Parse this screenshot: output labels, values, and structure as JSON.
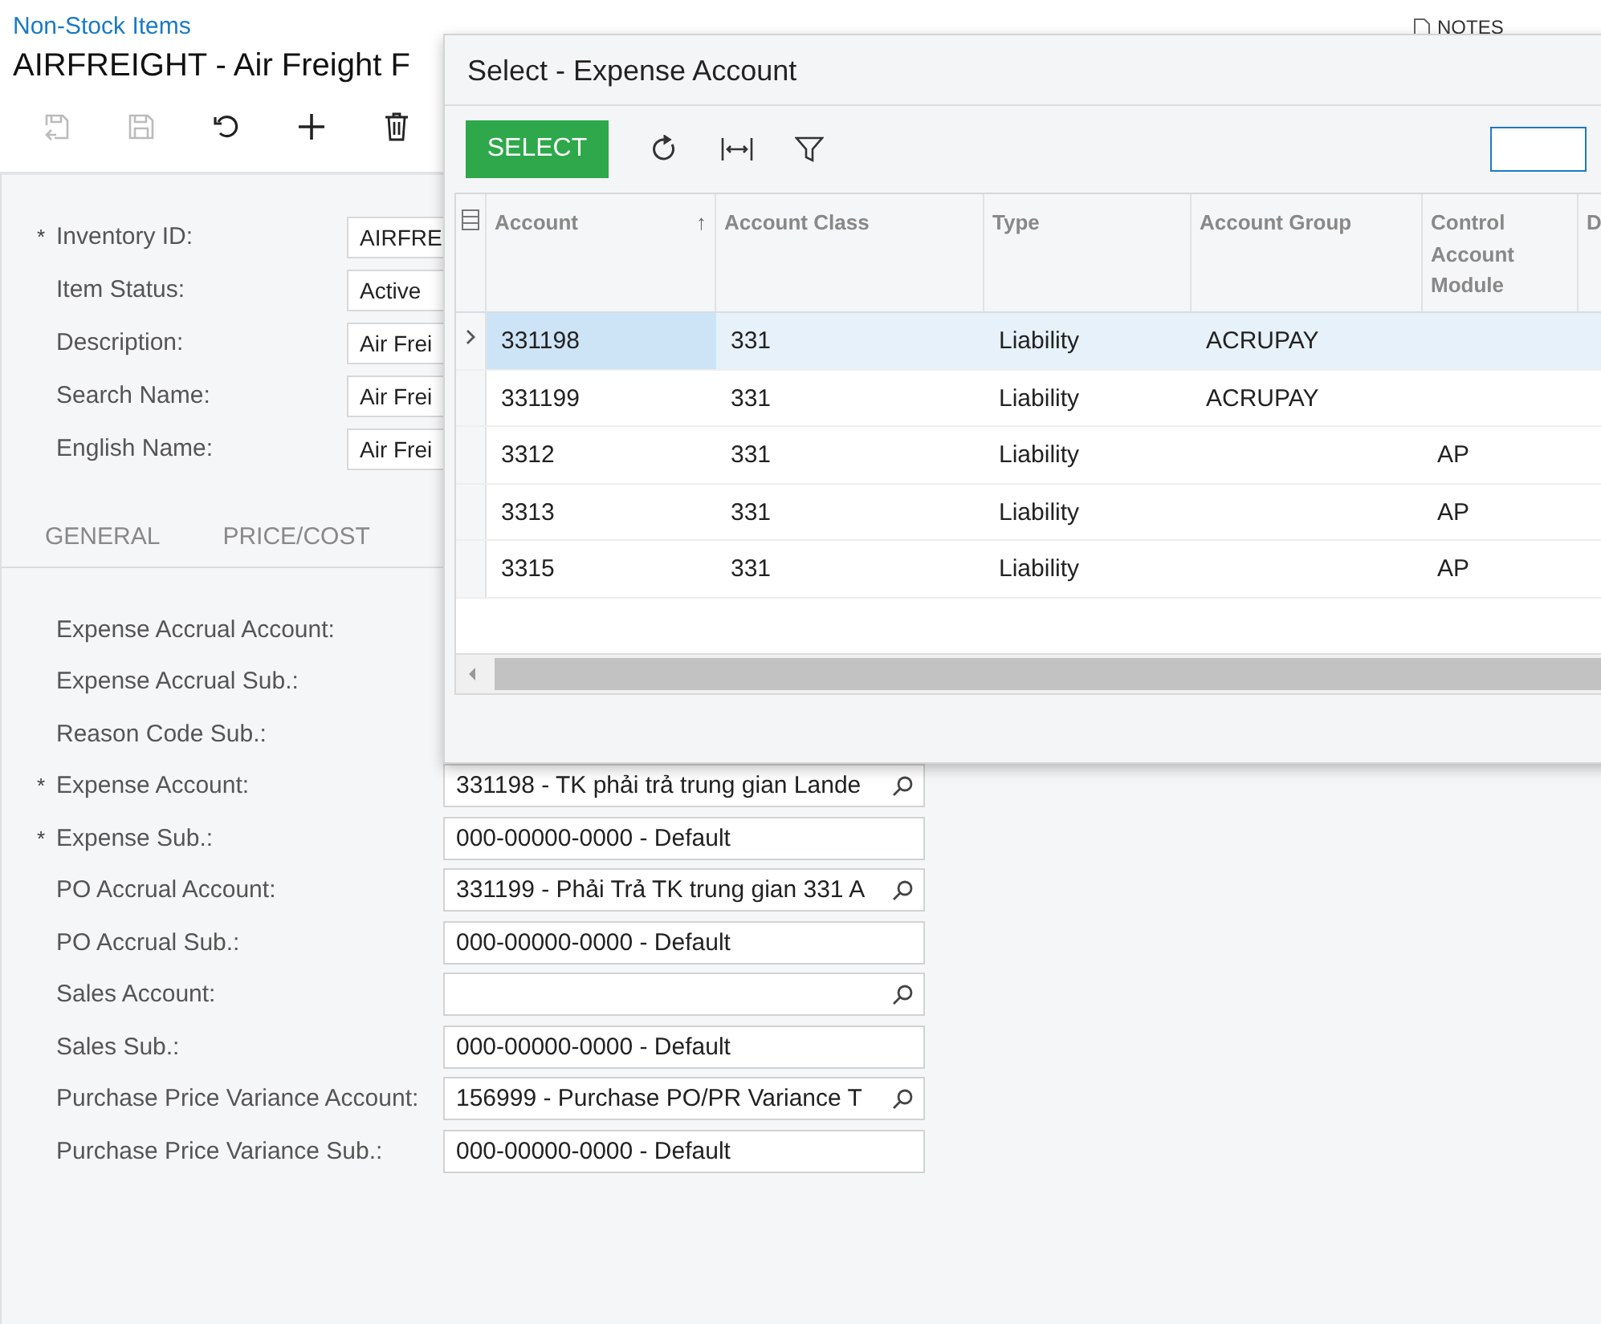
{
  "breadcrumb": "Non-Stock Items",
  "title": "AIRFREIGHT - Air Freight F",
  "header_action": "NOTES",
  "required_mark": "*",
  "toolbar": [
    {
      "kind": "save-close",
      "disabled": true
    },
    {
      "kind": "save",
      "disabled": true
    },
    {
      "kind": "undo",
      "disabled": false
    },
    {
      "kind": "add",
      "disabled": false
    },
    {
      "kind": "delete",
      "disabled": false
    }
  ],
  "summary_fields": [
    {
      "label": "Inventory ID:",
      "required": true,
      "value": "AIRFRE"
    },
    {
      "label": "Item Status:",
      "required": false,
      "value": "Active"
    },
    {
      "label": "Description:",
      "required": false,
      "value": "Air Frei"
    },
    {
      "label": "Search Name:",
      "required": false,
      "value": "Air Frei"
    },
    {
      "label": "English Name:",
      "required": false,
      "value": "Air Frei"
    }
  ],
  "tabs": [
    "GENERAL",
    "PRICE/COST"
  ],
  "gl_fields": [
    {
      "label": "Expense Accrual Account:",
      "required": false,
      "kind": "covered"
    },
    {
      "label": "Expense Accrual Sub.:",
      "required": false,
      "kind": "covered"
    },
    {
      "label": "Reason Code Sub.:",
      "required": false,
      "kind": "covered"
    },
    {
      "label": "Expense Account:",
      "required": true,
      "kind": "lookup",
      "value": "331198 - TK phải trả trung gian Lande"
    },
    {
      "label": "Expense Sub.:",
      "required": true,
      "kind": "text",
      "value": "000-00000-0000 - Default"
    },
    {
      "label": "PO Accrual Account:",
      "required": false,
      "kind": "lookup",
      "value": "331199 - Phải Trả TK trung gian 331 A"
    },
    {
      "label": "PO Accrual Sub.:",
      "required": false,
      "kind": "text",
      "value": "000-00000-0000 - Default"
    },
    {
      "label": "Sales Account:",
      "required": false,
      "kind": "lookup"
    },
    {
      "label": "Sales Sub.:",
      "required": false,
      "kind": "text",
      "value": "000-00000-0000 - Default"
    },
    {
      "label": "Purchase Price Variance Account:",
      "required": false,
      "kind": "lookup",
      "value": "156999 - Purchase PO/PR Variance T"
    },
    {
      "label": "Purchase Price Variance Sub.:",
      "required": false,
      "kind": "text",
      "value": "000-00000-0000 - Default"
    }
  ],
  "dialog": {
    "title": "Select - Expense Account",
    "select_button": "SELECT",
    "table": {
      "columns": [
        {
          "label": "Account",
          "sort": "↑"
        },
        {
          "label": "Account Class"
        },
        {
          "label": "Type"
        },
        {
          "label": "Account Group"
        },
        {
          "label": "Control Account Module"
        },
        {
          "label": "D"
        }
      ],
      "rows": [
        {
          "selected": true,
          "cells": [
            "331198",
            "331",
            "Liability",
            "ACRUPAY",
            ""
          ]
        },
        {
          "selected": false,
          "cells": [
            "331199",
            "331",
            "Liability",
            "ACRUPAY",
            ""
          ]
        },
        {
          "selected": false,
          "cells": [
            "3312",
            "331",
            "Liability",
            "",
            "AP"
          ]
        },
        {
          "selected": false,
          "cells": [
            "3313",
            "331",
            "Liability",
            "",
            "AP"
          ]
        },
        {
          "selected": false,
          "cells": [
            "3315",
            "331",
            "Liability",
            "",
            "AP"
          ]
        }
      ]
    }
  }
}
